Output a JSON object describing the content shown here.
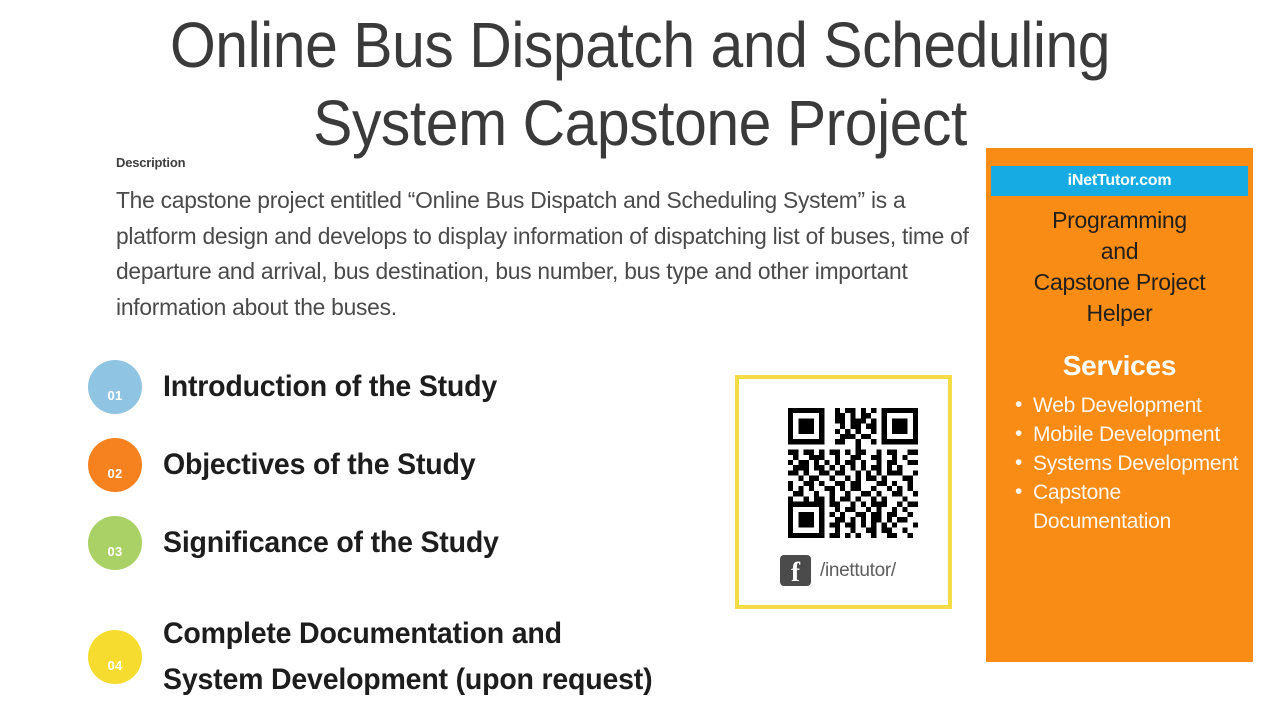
{
  "slide": {
    "title": "Online Bus Dispatch and Scheduling\nSystem Capstone Project"
  },
  "description": {
    "label": "Description",
    "text": "The capstone project entitled “Online Bus Dispatch and Scheduling System” is a platform design and develops to display information of dispatching list of buses, time of departure and arrival, bus destination, bus number, bus type and other important information about the buses."
  },
  "agenda": {
    "items": [
      {
        "number": "01",
        "label": "Introduction of the Study",
        "color": "#8FC4E3"
      },
      {
        "number": "02",
        "label": "Objectives of the Study",
        "color": "#F5821F"
      },
      {
        "number": "03",
        "label": "Significance of the Study",
        "color": "#A9D165"
      },
      {
        "number": "04",
        "label": "Complete Documentation and\nSystem Development (upon request)",
        "color": "#F5DC2E"
      }
    ]
  },
  "qr_panel": {
    "border_color": "#F3DC45",
    "social_icon": "facebook-icon",
    "social_icon_glyph": "f",
    "social_handle": "/inettutor/"
  },
  "promo": {
    "background_color": "#F98C14",
    "banner_color": "#16ACE3",
    "brand": "iNetTutor.com",
    "tagline": "Programming\nand\nCapstone Project\nHelper",
    "services_heading": "Services",
    "services": [
      "Web Development",
      "Mobile Development",
      "Systems Development",
      "Capstone Documentation"
    ]
  }
}
